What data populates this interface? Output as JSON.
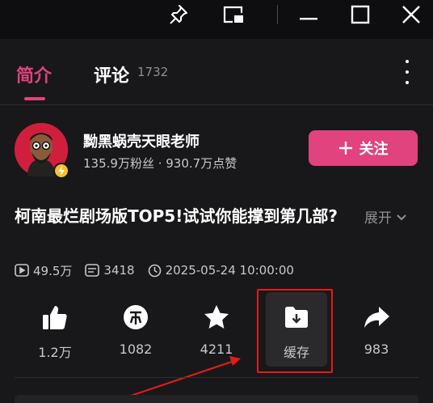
{
  "window": {
    "buttons": [
      "pin-icon",
      "pip-icon",
      "minimize-icon",
      "maximize-icon",
      "close-icon"
    ]
  },
  "tabs": [
    {
      "label": "简介",
      "active": true
    },
    {
      "label": "评论",
      "count": "1732",
      "active": false
    }
  ],
  "author": {
    "name": "黝黑蜗壳天眼老师",
    "stats": "135.9万粉丝 · 930.7万点赞",
    "follow_label": "关注"
  },
  "video": {
    "title": "柯南最烂剧场版TOP5!试试你能撑到第几部?",
    "expand_label": "展开",
    "plays": "49.5万",
    "danmaku": "3418",
    "date": "2025-05-24 10:00:00"
  },
  "actions": [
    {
      "name": "like",
      "icon": "thumbs-up-icon",
      "label": "1.2万"
    },
    {
      "name": "coin",
      "icon": "coin-icon",
      "label": "1082"
    },
    {
      "name": "favorite",
      "icon": "star-icon",
      "label": "4211"
    },
    {
      "name": "cache",
      "icon": "download-folder-icon",
      "label": "缓存"
    },
    {
      "name": "share",
      "icon": "share-arrow-icon",
      "label": "983"
    }
  ],
  "colors": {
    "accent": "#e0437d",
    "background": "#18181a",
    "highlight": "#e51a1a"
  }
}
